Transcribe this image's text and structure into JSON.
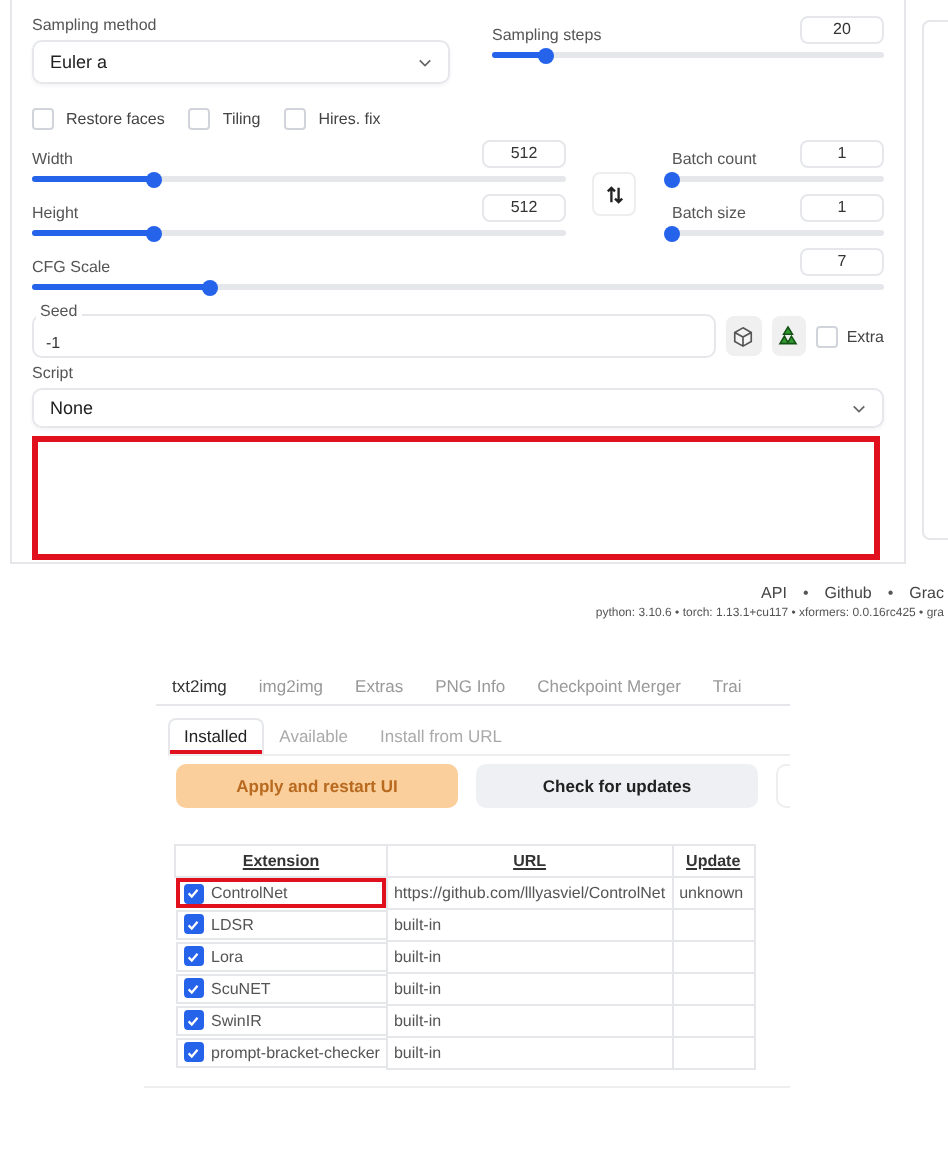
{
  "settings": {
    "sampling_method": {
      "label": "Sampling method",
      "value": "Euler a"
    },
    "sampling_steps": {
      "label": "Sampling steps",
      "value": "20",
      "level": 0.14
    },
    "options": [
      {
        "label": "Restore faces",
        "checked": false
      },
      {
        "label": "Tiling",
        "checked": false
      },
      {
        "label": "Hires. fix",
        "checked": false
      }
    ],
    "width": {
      "label": "Width",
      "value": "512",
      "level": 0.23
    },
    "height": {
      "label": "Height",
      "value": "512",
      "level": 0.23
    },
    "batch_count": {
      "label": "Batch count",
      "value": "1",
      "level": 0
    },
    "batch_size": {
      "label": "Batch size",
      "value": "1",
      "level": 0
    },
    "cfg_scale": {
      "label": "CFG Scale",
      "value": "7",
      "level": 0.21
    },
    "seed": {
      "label": "Seed",
      "value": "-1"
    },
    "extra": {
      "label": "Extra",
      "checked": false
    },
    "script": {
      "label": "Script",
      "value": "None"
    },
    "script_area": {
      "highlighted": true
    }
  },
  "footer": {
    "links": [
      "API",
      "Github",
      "Grac"
    ],
    "separator": "•",
    "versions": "python: 3.10.6  •  torch: 1.13.1+cu117  •  xformers: 0.0.16rc425  •  gra"
  },
  "extensions_page": {
    "tabs": [
      {
        "label": "txt2img",
        "selected": true
      },
      {
        "label": "img2img",
        "selected": false
      },
      {
        "label": "Extras",
        "selected": false
      },
      {
        "label": "PNG Info",
        "selected": false
      },
      {
        "label": "Checkpoint Merger",
        "selected": false
      },
      {
        "label": "Trai",
        "selected": false
      }
    ],
    "subtabs": [
      {
        "label": "Installed",
        "selected": true,
        "highlighted": true
      },
      {
        "label": "Available",
        "selected": false,
        "highlighted": false
      },
      {
        "label": "Install from URL",
        "selected": false,
        "highlighted": false
      }
    ],
    "buttons": [
      {
        "label": "Apply and restart UI",
        "kind": "primary"
      },
      {
        "label": "Check for updates",
        "kind": "secondary"
      }
    ],
    "table": {
      "columns": [
        "Extension",
        "URL",
        "Update"
      ],
      "rows": [
        {
          "extension": "ControlNet",
          "checked": true,
          "highlighted": true,
          "url": "https://github.com/lllyasviel/ControlNet",
          "update": "unknown"
        },
        {
          "extension": "LDSR",
          "checked": true,
          "highlighted": false,
          "url": "built-in"
        },
        {
          "extension": "Lora",
          "checked": true,
          "highlighted": false,
          "url": "built-in"
        },
        {
          "extension": "ScuNET",
          "checked": true,
          "highlighted": false,
          "url": "built-in"
        },
        {
          "extension": "SwinIR",
          "checked": true,
          "highlighted": false,
          "url": "built-in"
        },
        {
          "extension": "prompt-bracket-checker",
          "checked": true,
          "highlighted": false,
          "url": "built-in"
        }
      ]
    }
  }
}
